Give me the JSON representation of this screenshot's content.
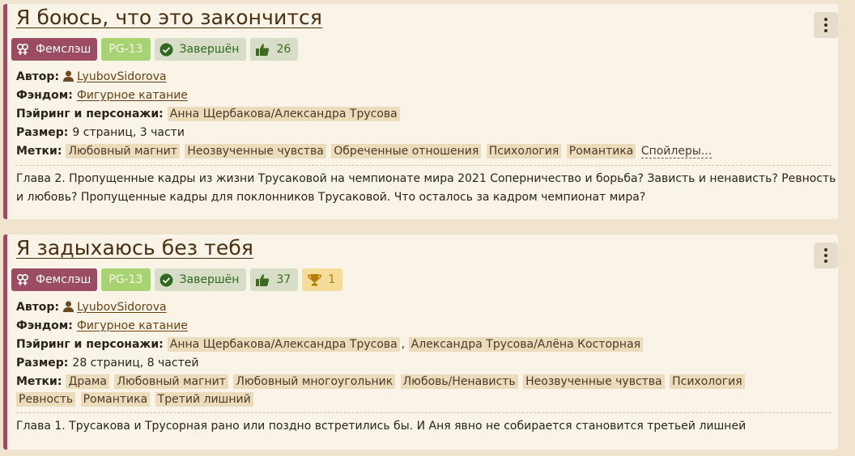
{
  "colors": {
    "accent": "#9b4c63",
    "rating": "#a7d372",
    "status": "#2d6a1e",
    "background": "#f0e4cf",
    "card": "#faf4e8",
    "tag_bg": "#eddcbc"
  },
  "labels": {
    "author": "Автор:",
    "fandom": "Фэндом:",
    "pairing": "Пэйринг и персонажи:",
    "size": "Размер:",
    "tags": "Метки:"
  },
  "fics": [
    {
      "title": "Я боюсь, что это закончится",
      "direction": "Фемслэш",
      "rating": "PG-13",
      "status": "Завершён",
      "likes": "26",
      "author": "LyubovSidorova",
      "fandom": "Фигурное катание",
      "pairings": [
        "Анна Щербакова/Александра Трусова"
      ],
      "size": "9 страниц, 3 части",
      "tags": [
        "Любовный магнит",
        "Неозвученные чувства",
        "Обреченные отношения",
        "Психология",
        "Романтика"
      ],
      "spoilers": "Спойлеры...",
      "description": "Глава 2. Пропущенные кадры из жизни Трусаковой на чемпионате мира 2021 Соперничество и борьба? Зависть и ненависть? Ревность и любовь? Пропущенные кадры для поклонников Трусаковой. Что осталось за кадром чемпионат мира?"
    },
    {
      "title": "Я задыхаюсь без тебя",
      "direction": "Фемслэш",
      "rating": "PG-13",
      "status": "Завершён",
      "likes": "37",
      "awards": "1",
      "author": "LyubovSidorova",
      "fandom": "Фигурное катание",
      "pairings": [
        "Анна Щербакова/Александра Трусова",
        "Александра Трусова/Алёна Косторная"
      ],
      "pairing_sep": ",",
      "size": "28 страниц, 8 частей",
      "tags": [
        "Драма",
        "Любовный магнит",
        "Любовный многоугольник",
        "Любовь/Ненависть",
        "Неозвученные чувства",
        "Психология",
        "Ревность",
        "Романтика",
        "Третий лишний"
      ],
      "description": "Глава 1. Трусакова и Трусорная рано или поздно встретились бы. И Аня явно не собирается становится третьей лишней"
    }
  ]
}
